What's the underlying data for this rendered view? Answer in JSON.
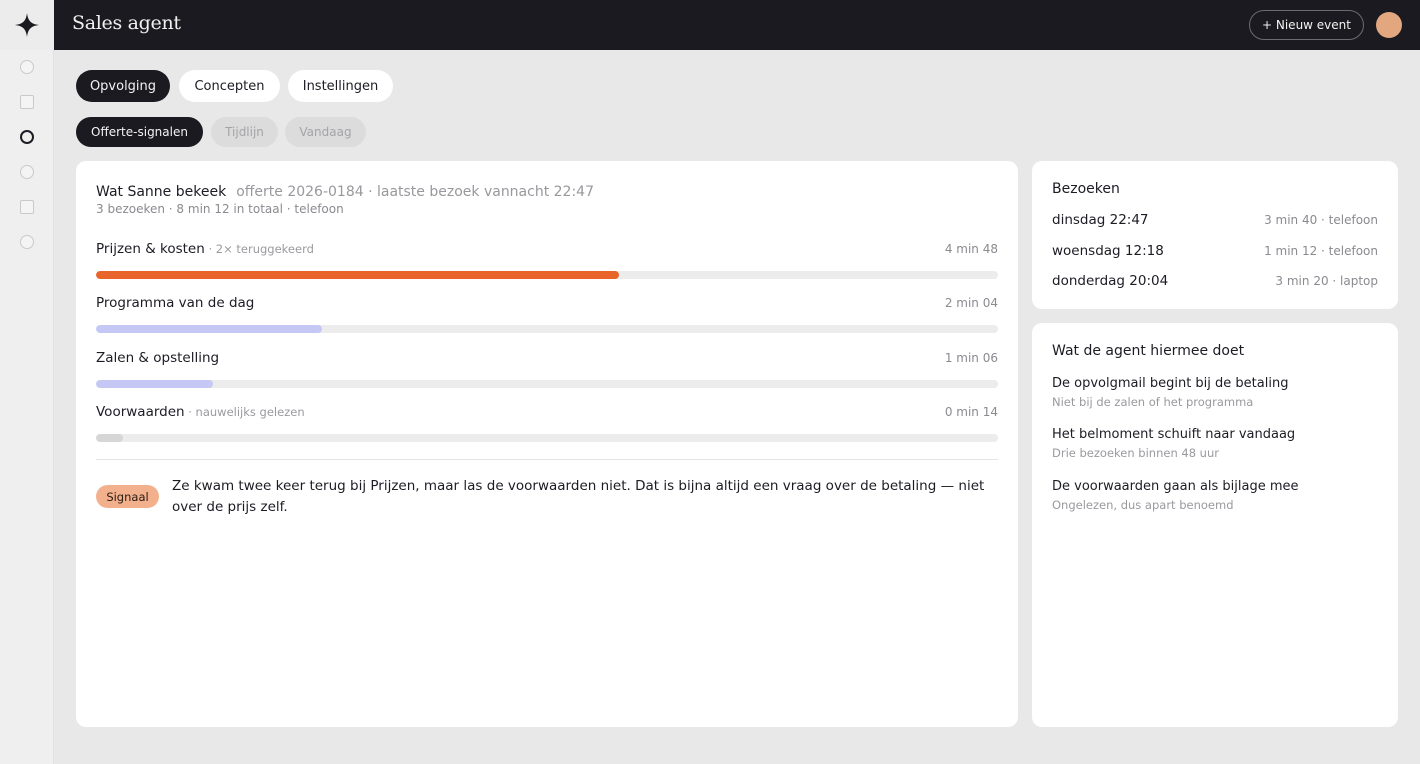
{
  "app": {
    "title": "Sales agent",
    "new_event_label": "+ Nieuw event"
  },
  "colors": {
    "topbar": "#1b1a21",
    "accent_orange": "#e8642a",
    "accent_lavender": "#c5c8f4",
    "muted_bar": "#d6d6d6",
    "badge": "#f3b08c",
    "avatar": "#e2a77e"
  },
  "rail": {
    "logo_icon": "sparkle-icon",
    "items": [
      "circle",
      "square",
      "circle",
      "circle",
      "square",
      "circle"
    ],
    "active_index": 2
  },
  "tabs": [
    {
      "label": "Opvolging",
      "active": true
    },
    {
      "label": "Concepten",
      "active": false
    },
    {
      "label": "Instellingen",
      "active": false
    }
  ],
  "subtabs": [
    {
      "label": "Offerte-signalen",
      "active": true
    },
    {
      "label": "Tijdlijn",
      "active": false
    },
    {
      "label": "Vandaag",
      "active": false
    }
  ],
  "main": {
    "title": "Wat Sanne bekeek",
    "meta": "offerte 2026-0184 · laatste bezoek vannacht 22:47",
    "summary": "3 bezoeken · 8 min 12 in totaal · telefoon",
    "sections": [
      {
        "label": "Prijzen & kosten",
        "note": " · 2× teruggekeerd",
        "duration": "4 min 48",
        "fraction": 0.58,
        "color": "#e8642a"
      },
      {
        "label": "Programma van de dag",
        "note": "",
        "duration": "2 min 04",
        "fraction": 0.25,
        "color": "#c5c8f4"
      },
      {
        "label": "Zalen & opstelling",
        "note": "",
        "duration": "1 min 06",
        "fraction": 0.13,
        "color": "#c5c8f4"
      },
      {
        "label": "Voorwaarden",
        "note": " · nauwelijks gelezen",
        "duration": "0 min 14",
        "fraction": 0.03,
        "color": "#d6d6d6"
      }
    ],
    "signal": {
      "badge": "Signaal",
      "text": "Ze kwam twee keer terug bij Prijzen, maar las de voorwaarden niet. Dat is bijna altijd een vraag over de betaling — niet over de prijs zelf."
    }
  },
  "visits": {
    "title": "Bezoeken",
    "items": [
      {
        "day": "dinsdag 22:47",
        "detail": "3 min 40 · telefoon"
      },
      {
        "day": "woensdag 12:18",
        "detail": "1 min 12 · telefoon"
      },
      {
        "day": "donderdag 20:04",
        "detail": "3 min 20 · laptop"
      }
    ]
  },
  "agent": {
    "title": "Wat de agent hiermee doet",
    "actions": [
      {
        "title": "De opvolgmail begint bij de betaling",
        "sub": "Niet bij de zalen of het programma"
      },
      {
        "title": "Het belmoment schuift naar vandaag",
        "sub": "Drie bezoeken binnen 48 uur"
      },
      {
        "title": "De voorwaarden gaan als bijlage mee",
        "sub": "Ongelezen, dus apart benoemd"
      }
    ]
  }
}
